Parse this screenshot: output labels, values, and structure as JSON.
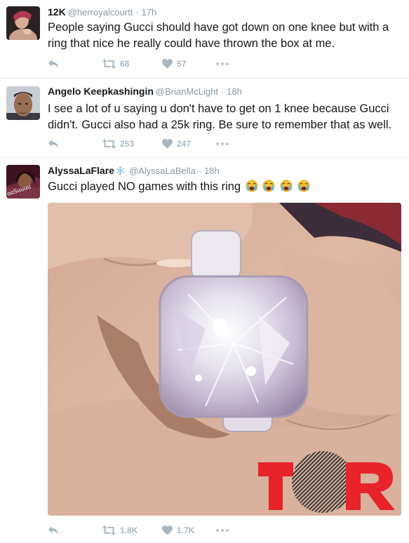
{
  "tweets": [
    {
      "name": "12K",
      "handle": "@herroyalcourtt",
      "time": "17h",
      "text": "People saying Gucci should have got down on one knee but with a ring that nice he really could have thrown the box at me.",
      "retweets": "68",
      "likes": "57"
    },
    {
      "name": "Angelo Keepkashingin",
      "handle": "@BrianMcLight",
      "time": "18h",
      "text": "I see a lot of u saying u don't have to get on 1 knee because Gucci didn't. Gucci also had a 25k ring. Be sure to remember that as well.",
      "retweets": "253",
      "likes": "247"
    },
    {
      "name": "AlyssaLaFlare",
      "handle": "@AlyssaLaBella",
      "time": "18h",
      "text": "Gucci played NO games with this ring",
      "emoji": "loudly-crying-face",
      "emoji_count": 4,
      "retweets": "1.8K",
      "likes": "1.7K",
      "avatar_text": "ooSuuuu",
      "media_watermark": "TSR"
    }
  ],
  "separator": "·",
  "colors": {
    "name": "#14171a",
    "muted": "#8899a6",
    "action_icon": "#aab8c2",
    "divider": "#e1e8ed",
    "watermark_red": "#e8232a"
  }
}
